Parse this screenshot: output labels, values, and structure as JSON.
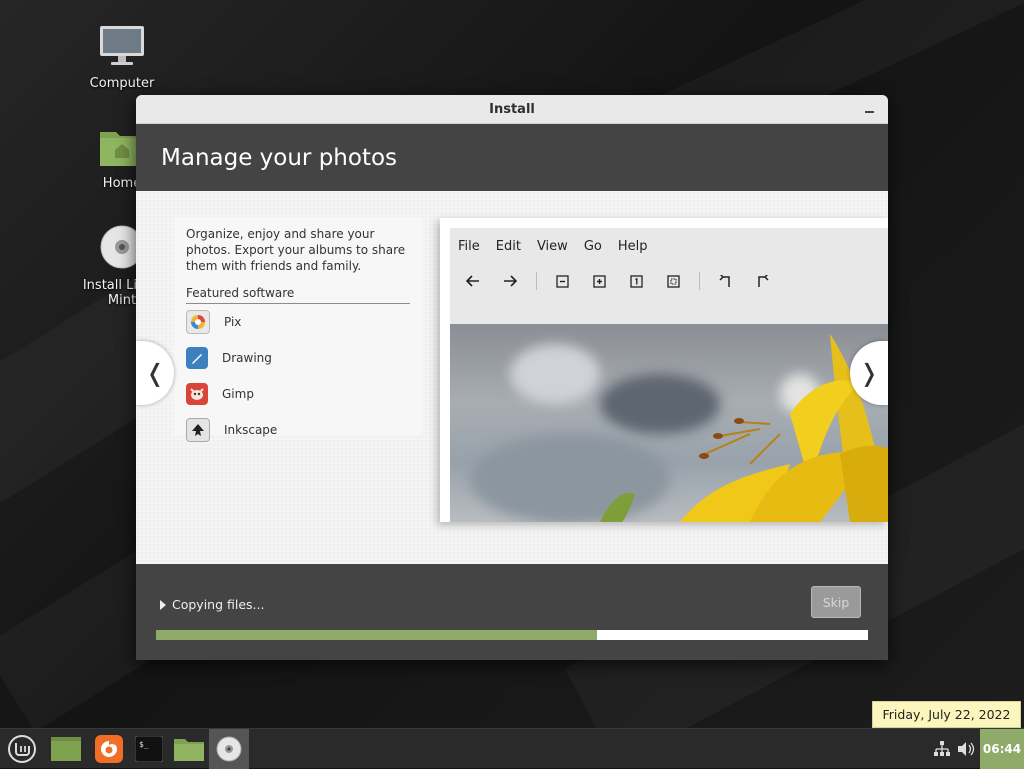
{
  "desktop": {
    "icons": [
      {
        "label": "Computer"
      },
      {
        "label": "Home"
      },
      {
        "label": "Install Linux Mint"
      }
    ]
  },
  "window": {
    "title": "Install",
    "header": "Manage your photos",
    "slide": {
      "description": "Organize, enjoy and share your photos. Export your albums to share them with friends and family.",
      "featured_label": "Featured software",
      "software": [
        {
          "name": "Pix",
          "icon": "pix-icon"
        },
        {
          "name": "Drawing",
          "icon": "drawing-icon"
        },
        {
          "name": "Gimp",
          "icon": "gimp-icon"
        },
        {
          "name": "Inkscape",
          "icon": "inkscape-icon"
        }
      ],
      "screenshot_menu": [
        "File",
        "Edit",
        "View",
        "Go",
        "Help"
      ]
    },
    "footer": {
      "status": "Copying files...",
      "skip_label": "Skip",
      "progress_percent": 62
    }
  },
  "taskbar": {
    "clock": "06:44",
    "tooltip": "Friday, July 22, 2022"
  },
  "colors": {
    "accent": "#8fab6a",
    "header_bg": "#444444",
    "window_bg": "#ededed"
  }
}
